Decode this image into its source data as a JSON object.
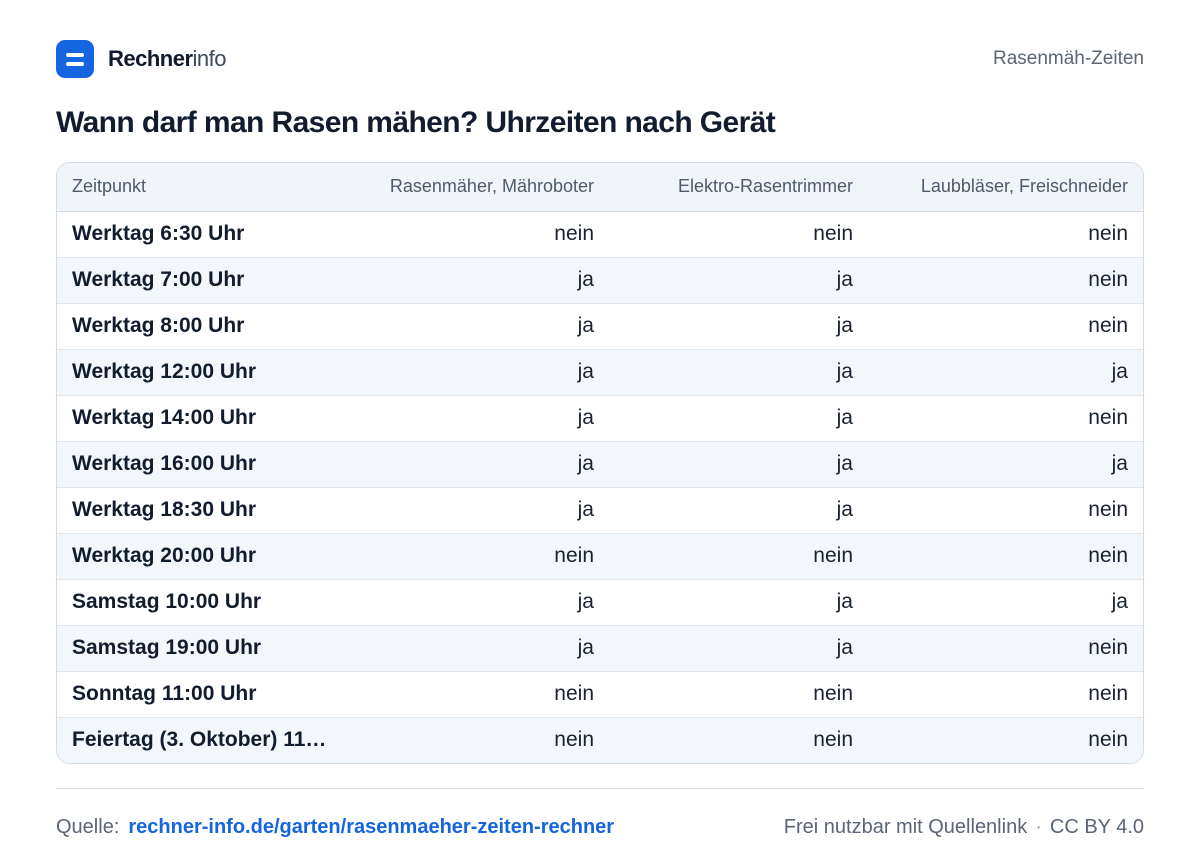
{
  "header": {
    "brand_bold": "Rechner",
    "brand_light": "info",
    "page_tag": "Rasenmäh-Zeiten"
  },
  "title": "Wann darf man Rasen mähen? Uhrzeiten nach Gerät",
  "table": {
    "columns": [
      "Zeitpunkt",
      "Rasenmäher, Mähroboter",
      "Elektro-Rasentrimmer",
      "Laubbläser, Freischneider"
    ],
    "rows": [
      [
        "Werktag 6:30 Uhr",
        "nein",
        "nein",
        "nein"
      ],
      [
        "Werktag 7:00 Uhr",
        "ja",
        "ja",
        "nein"
      ],
      [
        "Werktag 8:00 Uhr",
        "ja",
        "ja",
        "nein"
      ],
      [
        "Werktag 12:00 Uhr",
        "ja",
        "ja",
        "ja"
      ],
      [
        "Werktag 14:00 Uhr",
        "ja",
        "ja",
        "nein"
      ],
      [
        "Werktag 16:00 Uhr",
        "ja",
        "ja",
        "ja"
      ],
      [
        "Werktag 18:30 Uhr",
        "ja",
        "ja",
        "nein"
      ],
      [
        "Werktag 20:00 Uhr",
        "nein",
        "nein",
        "nein"
      ],
      [
        "Samstag 10:00 Uhr",
        "ja",
        "ja",
        "ja"
      ],
      [
        "Samstag 19:00 Uhr",
        "ja",
        "ja",
        "nein"
      ],
      [
        "Sonntag 11:00 Uhr",
        "nein",
        "nein",
        "nein"
      ],
      [
        "Feiertag (3. Oktober) 11: ...",
        "nein",
        "nein",
        "nein"
      ]
    ]
  },
  "footer": {
    "source_label": "Quelle:",
    "source_link": "rechner-info.de/garten/rasenmaeher-zeiten-rechner",
    "license_text": "Frei nutzbar mit Quellenlink",
    "separator": "·",
    "license_name": "CC BY 4.0"
  },
  "colors": {
    "accent": "#1565e0",
    "text": "#111c2e",
    "muted": "#5b6576",
    "header_bg": "#f1f4f8",
    "zebra_bg": "#f3f6fa",
    "border": "#d3dbe6"
  },
  "icons": {
    "logo": "rechnerinfo-logo-icon"
  }
}
